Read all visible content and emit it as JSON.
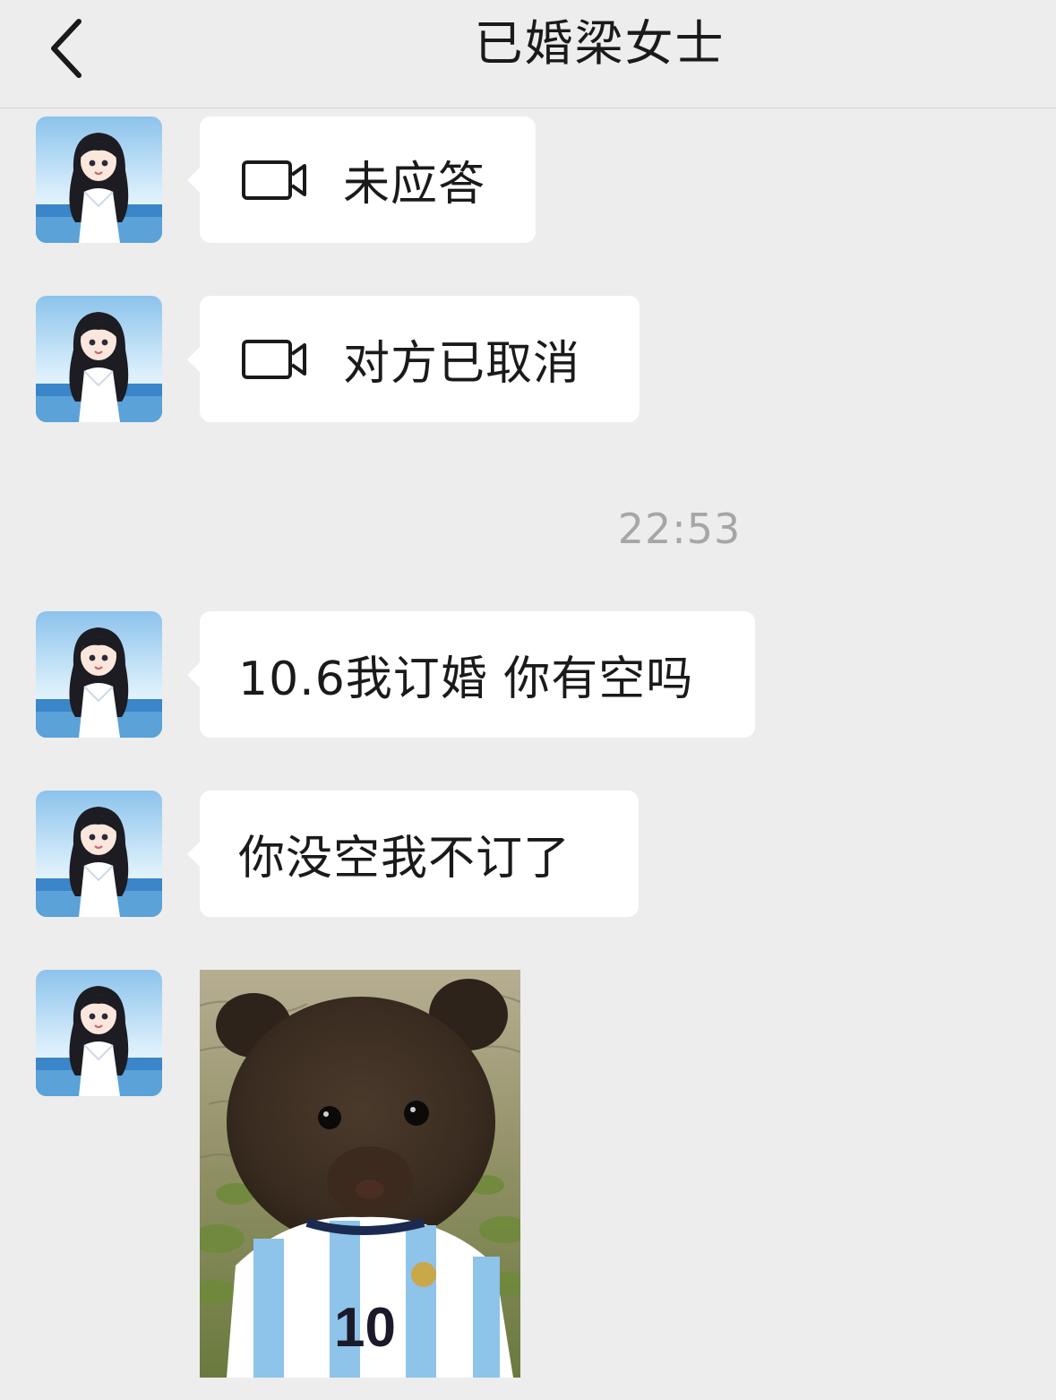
{
  "header": {
    "title": "已婚梁女士"
  },
  "messages": [
    {
      "type": "video_call",
      "text": "未应答"
    },
    {
      "type": "video_call",
      "text": "对方已取消"
    },
    {
      "type": "text",
      "text": "10.6我订婚 你有空吗"
    },
    {
      "type": "text",
      "text": "你没空我不订了"
    },
    {
      "type": "sticker",
      "description": "bear-in-jersey"
    }
  ],
  "timestamp": "22:53",
  "sticker": {
    "jersey_number": "10"
  },
  "colors": {
    "background": "#ededed",
    "bubble": "#ffffff",
    "text": "#1a1a1a",
    "timestamp": "#a6a6a6"
  }
}
